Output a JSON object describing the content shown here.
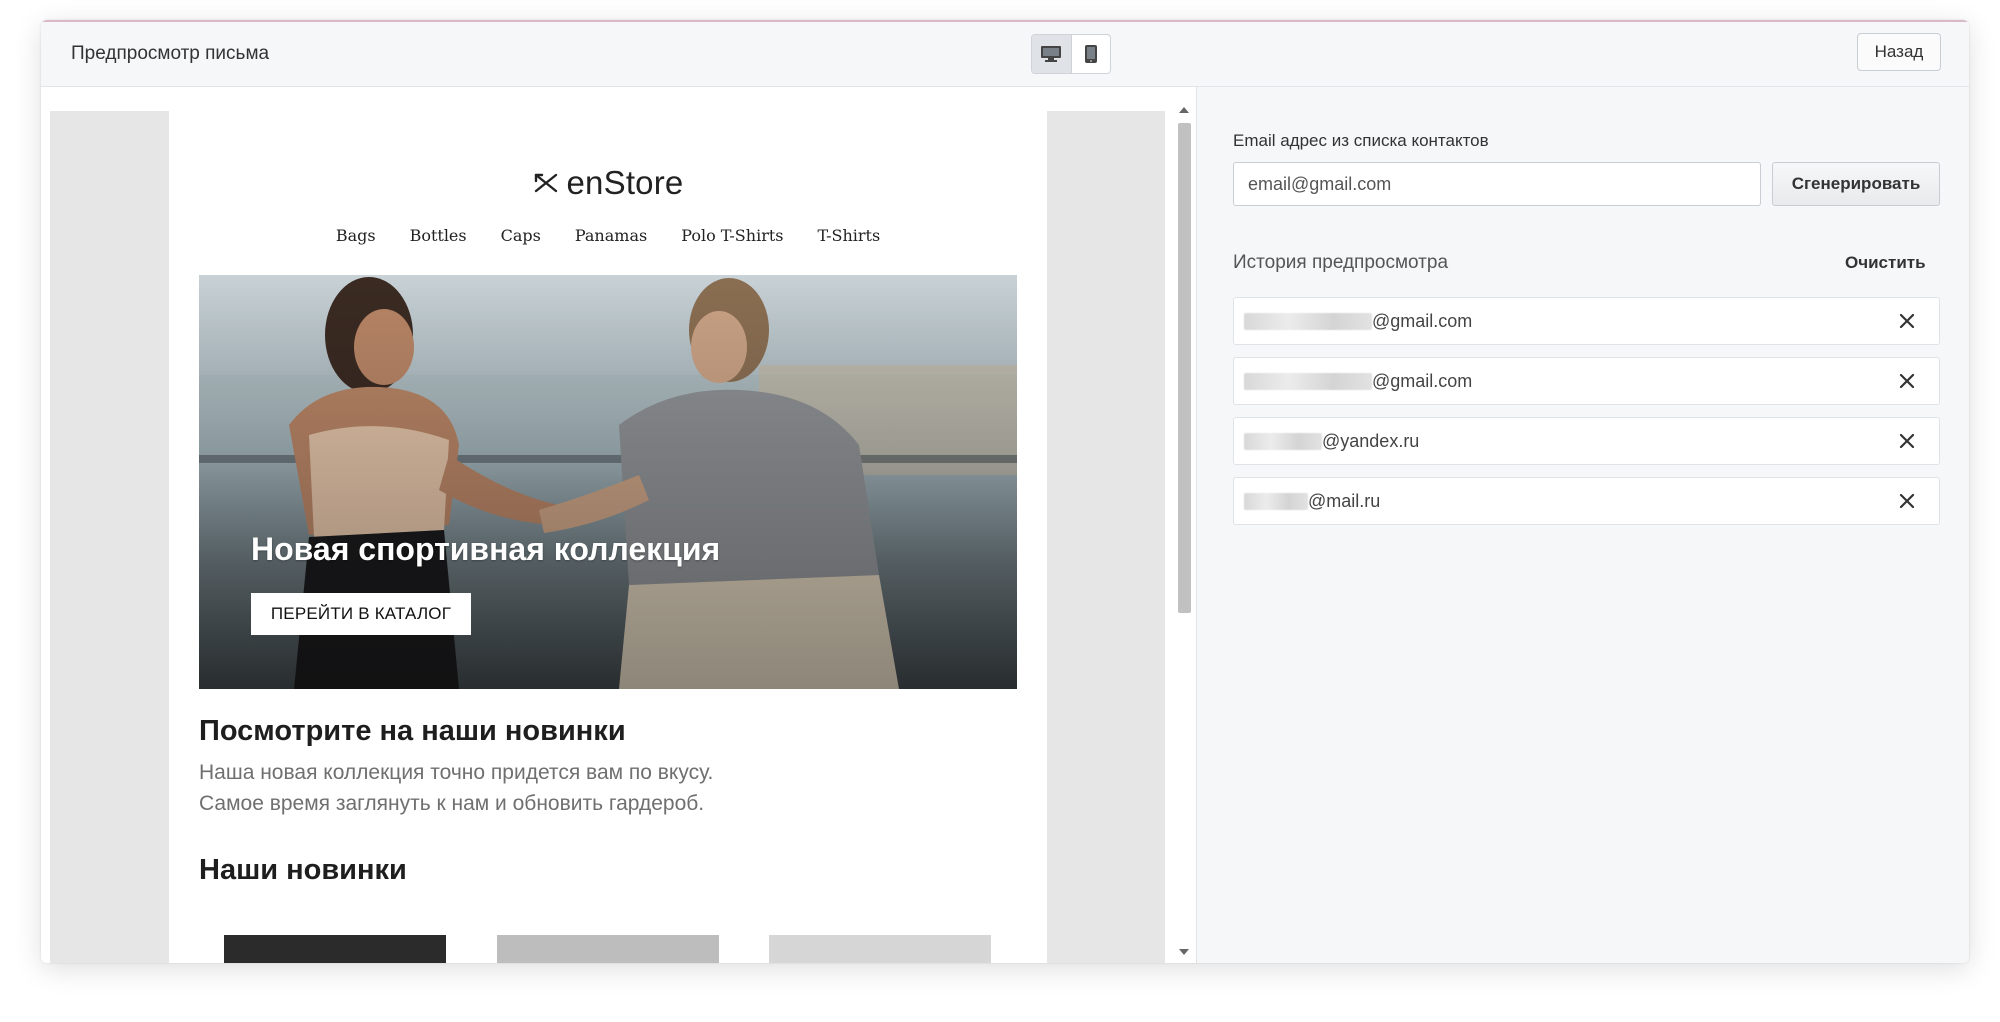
{
  "header": {
    "title": "Предпросмотр письма",
    "back_label": "Назад",
    "device_modes": [
      "desktop-icon",
      "mobile-icon"
    ]
  },
  "email": {
    "brand": "enStore",
    "nav": [
      "Bags",
      "Bottles",
      "Caps",
      "Panamas",
      "Polo T-Shirts",
      "T-Shirts"
    ],
    "hero_title": "Новая спортивная коллекция",
    "hero_button": "ПЕРЕЙТИ В КАТАЛОГ",
    "section1_title": "Посмотрите на наши новинки",
    "section1_line1": "Наша новая коллекция точно придется вам по вкусу.",
    "section1_line2": "Самое время заглянуть к нам и обновить гардероб.",
    "section2_title": "Наши новинки"
  },
  "sidebar": {
    "email_label": "Email адрес из списка контактов",
    "email_value": "email@gmail.com",
    "generate_label": "Сгенерировать",
    "history_title": "История предпросмотра",
    "clear_label": "Очистить",
    "history": [
      {
        "domain": "@gmail.com"
      },
      {
        "domain": "@gmail.com"
      },
      {
        "domain": "@yandex.ru"
      },
      {
        "domain": "@mail.ru"
      }
    ]
  },
  "colors": {
    "accent_line": "#d9b9c8",
    "panel_bg": "#f6f7f9",
    "canvas_bg": "#e6e6e6"
  }
}
